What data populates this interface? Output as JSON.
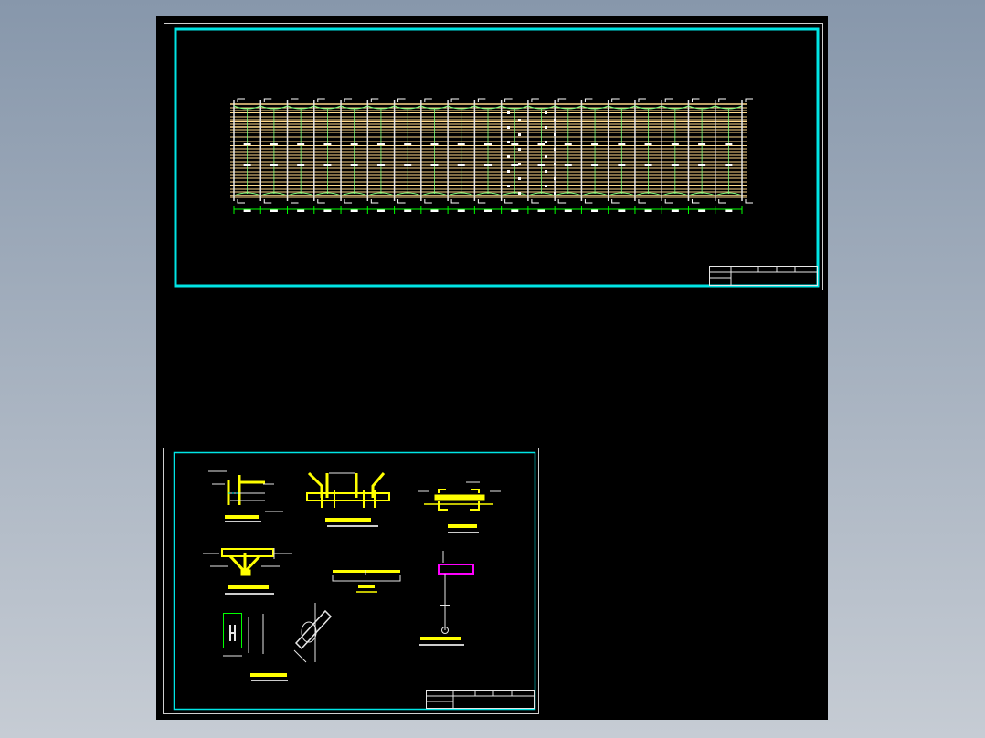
{
  "viewer": {
    "background_color": "#000000",
    "sheet_border_color": "#00e5e5",
    "frame_color": "#ffffff"
  },
  "sheets": [
    {
      "content": "framing-plan",
      "colors": {
        "column_lines": "#e6e6e6",
        "purlins": "#ffd98a",
        "bracing": "#7cff7c",
        "dimensions": "#00ff00"
      },
      "bays": 19
    },
    {
      "content": "connection-details",
      "colors": {
        "members": "#ffff00",
        "annotations": "#e6e6e6",
        "highlight": "#ff00ff",
        "plate": "#00ff00"
      }
    }
  ]
}
